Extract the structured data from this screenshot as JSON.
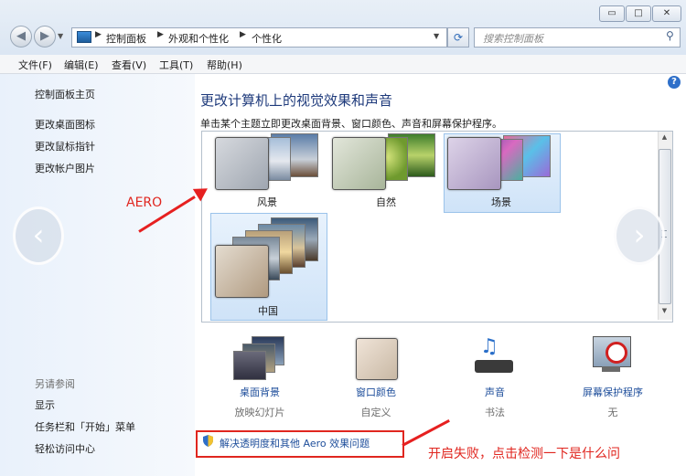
{
  "window": {
    "minimize_label": "▭",
    "maximize_label": "□",
    "close_label": "✕"
  },
  "breadcrumb": [
    "控制面板",
    "外观和个性化",
    "个性化"
  ],
  "search": {
    "placeholder": "搜索控制面板"
  },
  "menu": [
    "文件(F)",
    "编辑(E)",
    "查看(V)",
    "工具(T)",
    "帮助(H)"
  ],
  "sidebar": {
    "home": "控制面板主页",
    "tasks": [
      "更改桌面图标",
      "更改鼠标指针",
      "更改帐户图片"
    ],
    "see_also_title": "另请参阅",
    "see_also": [
      "显示",
      "任务栏和「开始」菜单",
      "轻松访问中心"
    ]
  },
  "main": {
    "title": "更改计算机上的视觉效果和声音",
    "description": "单击某个主题立即更改桌面背景、窗口颜色、声音和屏幕保护程序。",
    "help_label": "?"
  },
  "themes": [
    {
      "name": "风景",
      "selected": false
    },
    {
      "name": "自然",
      "selected": false
    },
    {
      "name": "场景",
      "selected": true
    },
    {
      "name": "中国",
      "selected": true
    }
  ],
  "options": [
    {
      "label": "桌面背景",
      "value": "放映幻灯片"
    },
    {
      "label": "窗口颜色",
      "value": "自定义"
    },
    {
      "label": "声音",
      "value": "书法"
    },
    {
      "label": "屏幕保护程序",
      "value": "无"
    }
  ],
  "troubleshoot": "解决透明度和其他 Aero 效果问题",
  "annotations": {
    "aero": "AERO",
    "fail": "开启失败，点击检测一下是什么问"
  },
  "colors": {
    "annotation_red": "#e0261f",
    "link_blue": "#1e4e9b",
    "title_blue": "#1e3a7b"
  }
}
